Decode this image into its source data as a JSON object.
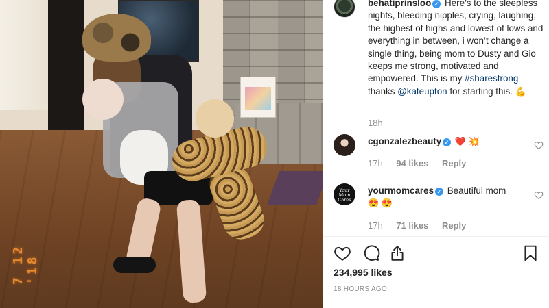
{
  "photo": {
    "date_stamp": "7 12 '18"
  },
  "caption": {
    "username": "behatiprinsloo",
    "text_part1": " Here’s to the sleepless nights, bleeding nipples, crying, laughing, the highest of highs and lowest of lows and everything in between, i won’t change a single thing, being mom to Dusty and Gio keeps me strong, motivated and empowered. This is my ",
    "hashtag": "#sharestrong",
    "text_part2": " thanks ",
    "mention": "@kateupton",
    "text_part3": " for starting this. ",
    "emoji": "💪",
    "time": "18h"
  },
  "comments": [
    {
      "username": "cgonzalezbeauty",
      "emojis": [
        "❤️",
        "💥"
      ],
      "time": "17h",
      "likes": "94 likes",
      "reply": "Reply"
    },
    {
      "username": "yourmomcares",
      "avatar_text": "Your Mom Cares",
      "text": " Beautiful mom",
      "emojis": [
        "😍",
        "😍"
      ],
      "time": "17h",
      "likes": "71 likes",
      "reply": "Reply"
    }
  ],
  "footer": {
    "likes_count": "234,995 likes",
    "post_time": "18 HOURS AGO"
  },
  "icons": {
    "like": "heart-outline-icon",
    "comment": "comment-bubble-icon",
    "share": "share-upload-icon",
    "save": "bookmark-icon",
    "verified": "verified-badge-icon"
  },
  "colors": {
    "verified": "#3897f0",
    "link": "#003569",
    "meta": "#8e8e8e",
    "text": "#262626"
  }
}
